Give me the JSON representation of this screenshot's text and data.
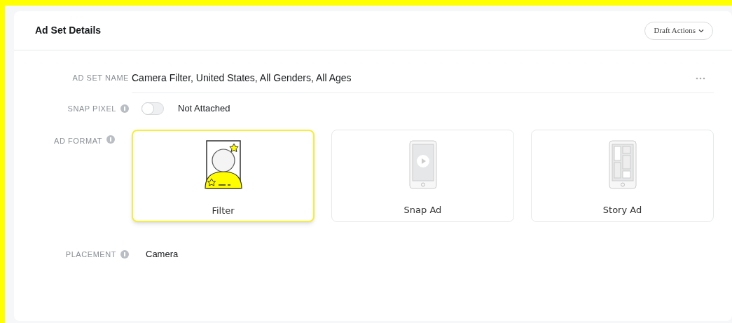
{
  "card": {
    "title": "Ad Set Details",
    "menu_button": "Draft Actions"
  },
  "ad_set_name": {
    "label": "AD SET NAME",
    "value": "Camera Filter, United States, All Genders, All Ages"
  },
  "snap_pixel": {
    "label": "SNAP PIXEL",
    "on": false,
    "status": "Not Attached"
  },
  "ad_format": {
    "label": "AD FORMAT",
    "options": [
      {
        "label": "Filter",
        "kind": "filter",
        "selected": true
      },
      {
        "label": "Snap Ad",
        "kind": "snap",
        "selected": false
      },
      {
        "label": "Story Ad",
        "kind": "story",
        "selected": false
      }
    ]
  },
  "placement": {
    "label": "PLACEMENT",
    "value": "Camera"
  }
}
